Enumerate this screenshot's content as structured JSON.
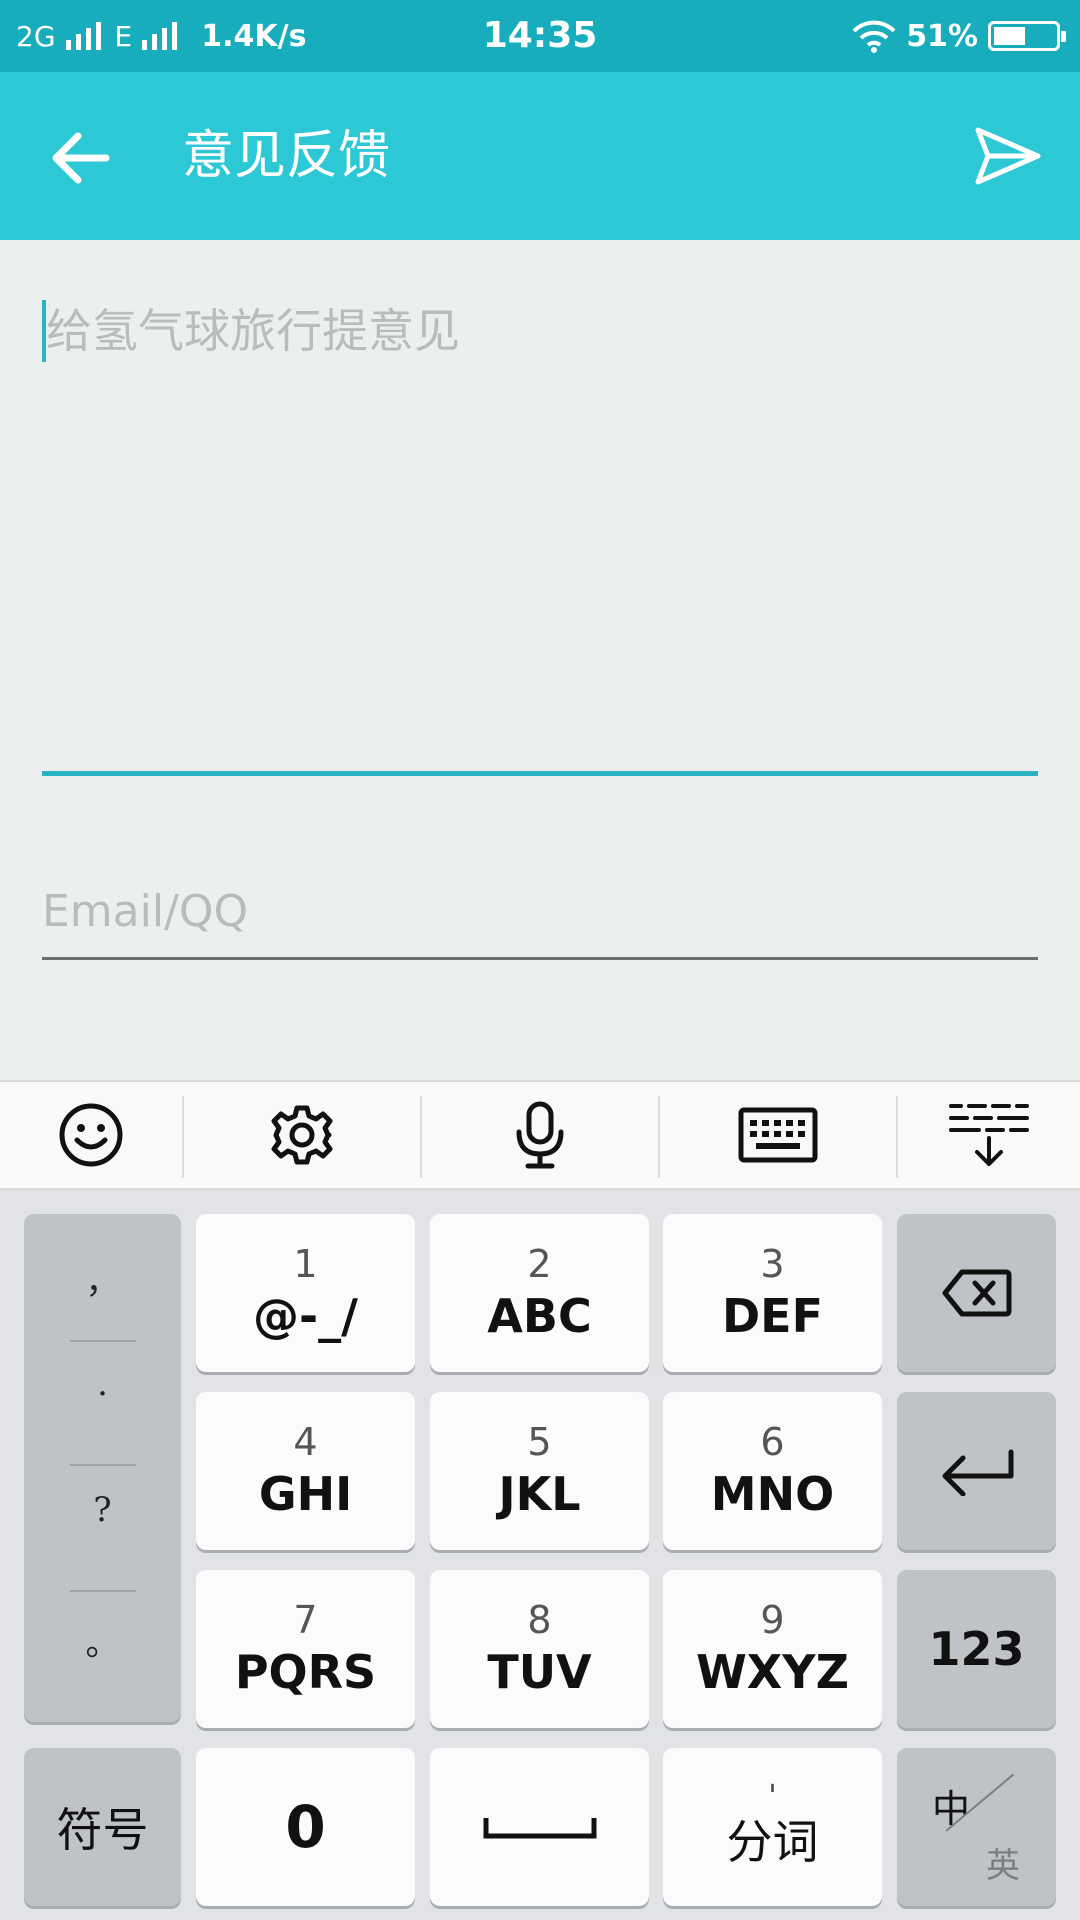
{
  "status_bar": {
    "network1": "2G",
    "network2": "E",
    "speed": "1.4K/s",
    "time": "14:35",
    "battery": "51%",
    "battery_level": 0.51
  },
  "app_bar": {
    "title": "意见反馈",
    "back_icon": "back-arrow-icon",
    "send_icon": "send-icon",
    "background_color": "#2cc8d5"
  },
  "form": {
    "feedback_placeholder": "给氢气球旅行提意见",
    "feedback_value": "",
    "contact_placeholder": "Email/QQ",
    "contact_value": "",
    "accent_color": "#2ab4c3"
  },
  "keyboard": {
    "toolbar": [
      "emoji-icon",
      "settings-icon",
      "microphone-icon",
      "keyboard-icon",
      "collapse-keyboard-icon"
    ],
    "punctuation": [
      "，",
      ".",
      "?",
      "。"
    ],
    "keys": [
      {
        "num": "1",
        "letters": "@-_/"
      },
      {
        "num": "2",
        "letters": "ABC"
      },
      {
        "num": "3",
        "letters": "DEF"
      },
      {
        "num": "4",
        "letters": "GHI"
      },
      {
        "num": "5",
        "letters": "JKL"
      },
      {
        "num": "6",
        "letters": "MNO"
      },
      {
        "num": "7",
        "letters": "PQRS"
      },
      {
        "num": "8",
        "letters": "TUV"
      },
      {
        "num": "9",
        "letters": "WXYZ"
      }
    ],
    "num_mode_label": "123",
    "symbol_label": "符号",
    "zero_label": "0",
    "fenci_tick": "'",
    "fenci_label": "分词",
    "lang_zh": "中",
    "lang_en": "英"
  }
}
